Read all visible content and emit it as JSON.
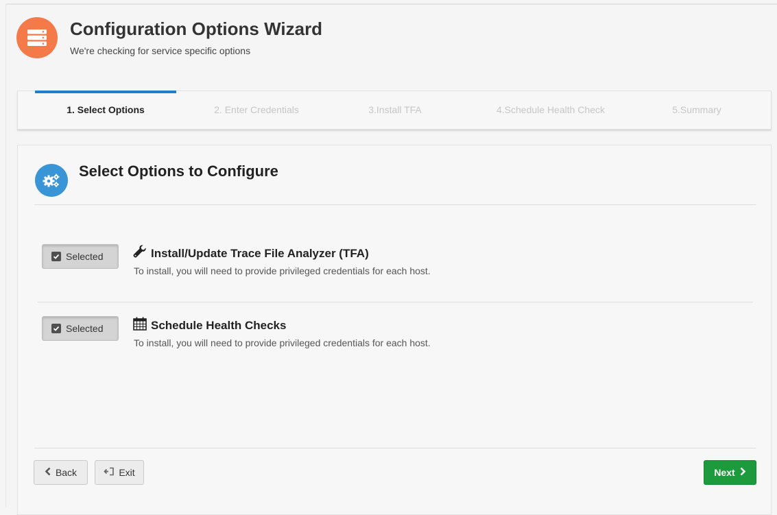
{
  "header": {
    "title": "Configuration Options Wizard",
    "subtitle": "We're checking for service specific options",
    "icon": "server-icon",
    "icon_color": "#f47a4a"
  },
  "steps": [
    {
      "label": "1. Select Options",
      "active": true
    },
    {
      "label": "2. Enter Credentials",
      "active": false
    },
    {
      "label": "3.Install TFA",
      "active": false
    },
    {
      "label": "4.Schedule Health Check",
      "active": false
    },
    {
      "label": "5.Summary",
      "active": false
    }
  ],
  "panel": {
    "title": "Select Options to Configure",
    "icon": "gears-icon",
    "options": [
      {
        "toggle_label": "Selected",
        "icon": "wrench-icon",
        "title": "Install/Update Trace File Analyzer (TFA)",
        "description": "To install, you will need to provide privileged credentials for each host."
      },
      {
        "toggle_label": "Selected",
        "icon": "calendar-icon",
        "title": "Schedule Health Checks",
        "description": "To install, you will need to provide privileged credentials for each host."
      }
    ]
  },
  "footer": {
    "back_label": "Back",
    "exit_label": "Exit",
    "next_label": "Next"
  },
  "colors": {
    "accent": "#1f7fcf",
    "next_button": "#1d9a3c",
    "panel_icon": "#3a95d7"
  }
}
